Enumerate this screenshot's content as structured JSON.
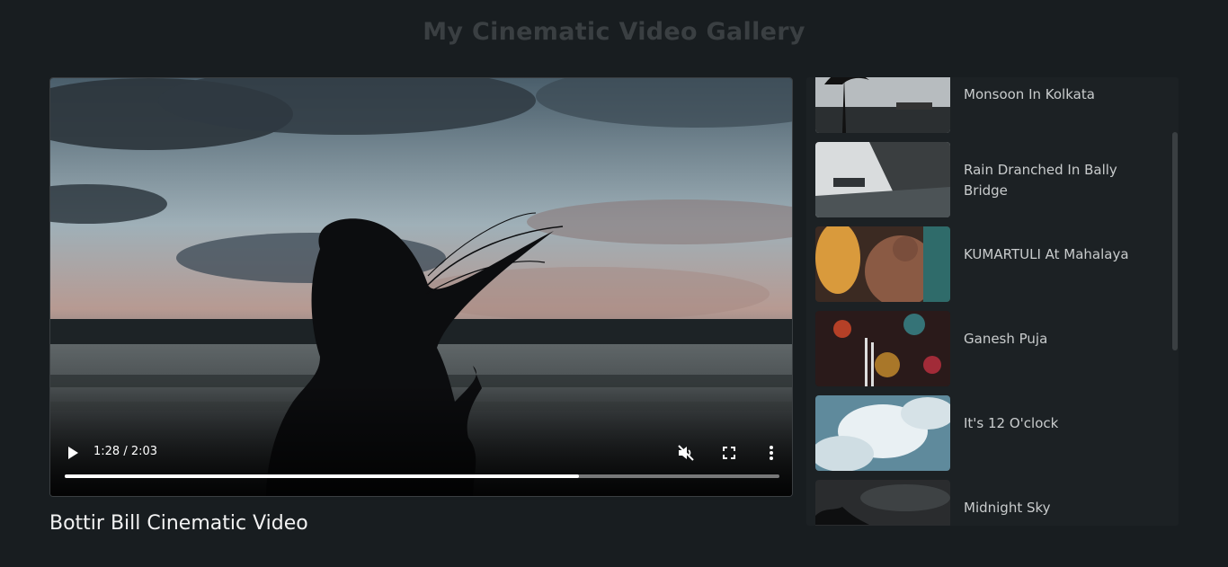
{
  "page": {
    "title": "My Cinematic Video Gallery"
  },
  "player": {
    "current_time": "1:28",
    "duration": "2:03",
    "time_display": "1:28 / 2:03",
    "progress": 0.72,
    "muted": true,
    "icons": {
      "play": "play-icon",
      "mute": "volume-muted-icon",
      "fullscreen": "fullscreen-icon",
      "more": "more-vertical-icon"
    }
  },
  "video": {
    "title": "Bottir Bill Cinematic Video"
  },
  "playlist": {
    "items": [
      {
        "label": "Monsoon In Kolkata"
      },
      {
        "label": "Rain Dranched In Bally Bridge"
      },
      {
        "label": "KUMARTULI At Mahalaya"
      },
      {
        "label": "Ganesh Puja"
      },
      {
        "label": "It's 12 O'clock"
      },
      {
        "label": "Midnight Sky"
      }
    ]
  },
  "colors": {
    "background": "#181d20",
    "panel": "#1c2124",
    "title": "#3a3f42",
    "accent": "#ffffff"
  }
}
